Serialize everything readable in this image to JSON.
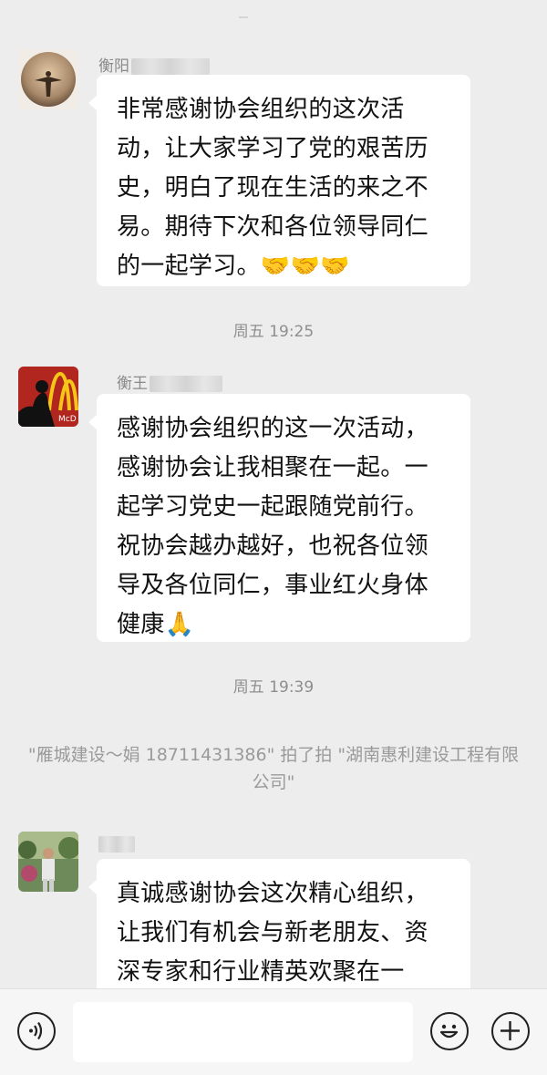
{
  "messages": [
    {
      "sender_visible": "衡阳",
      "text": "非常感谢协会组织的这次活动，让大家学习了党的艰苦历史，明白了现在生活的来之不易。期待下次和各位领导同仁的一起学习。🤝🤝🤝"
    },
    {
      "sender_visible": "衡王",
      "text": "感谢协会组织的这一次活动，感谢协会让我相聚在一起。一起学习党史一起跟随党前行。祝协会越办越好，也祝各位领导及各位同仁，事业红火身体健康🙏"
    },
    {
      "sender_visible": "",
      "text": "真诚感谢协会这次精心组织，让我们有机会与新老朋友、资深专家和行业精英欢聚在一起，"
    }
  ],
  "timestamps": [
    "周五 19:25",
    "周五 19:39"
  ],
  "system_message": "\"雁城建设～娟 18711431386\" 拍了拍 \"湖南惠利建设工程有限公司\"",
  "input_bar": {
    "voice_icon": "voice-icon",
    "emoji_icon": "emoji-icon",
    "add_icon": "plus-icon",
    "input_value": ""
  },
  "colors": {
    "background": "#ededed",
    "bubble": "#ffffff",
    "accent_avatar2": "#d8322a"
  }
}
